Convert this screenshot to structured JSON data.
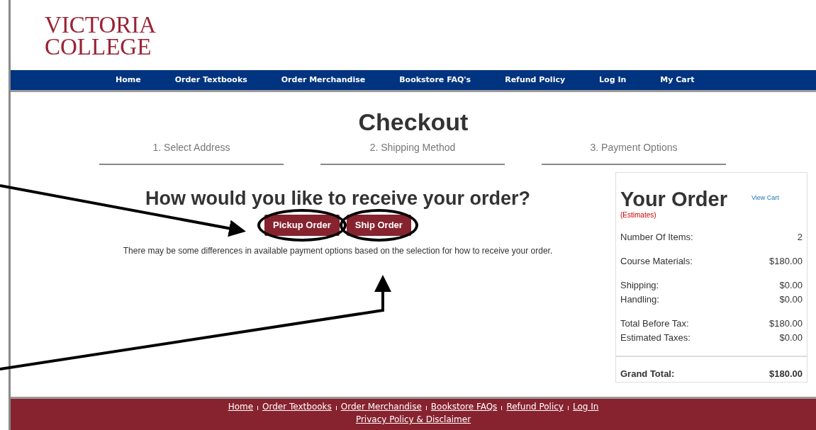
{
  "logo": {
    "line_1": "VICTORIA",
    "line_2": "COLLEGE"
  },
  "nav": [
    "Home",
    "Order Textbooks",
    "Order Merchandise",
    "Bookstore FAQ's",
    "Refund Policy",
    "Log In",
    "My Cart"
  ],
  "page_title": "Checkout",
  "steps": [
    "1. Select Address",
    "2. Shipping Method",
    "3. Payment Options"
  ],
  "question": "How would you like to receive your order?",
  "buttons": [
    "Pickup Order",
    "Ship Order"
  ],
  "note": "There may be some differences in available payment options based on the selection for how to receive your order.",
  "order_summary": {
    "title": "Your Order",
    "subtitle": "(Estimates)",
    "view_cart": "View Cart",
    "groups": [
      [
        {
          "label": "Number Of Items:",
          "value": "2"
        }
      ],
      [
        {
          "label": "Course Materials:",
          "value": "$180.00"
        }
      ],
      [
        {
          "label": "Shipping:",
          "value": "$0.00"
        },
        {
          "label": "Handling:",
          "value": "$0.00"
        }
      ],
      [
        {
          "label": "Total Before Tax:",
          "value": "$180.00"
        },
        {
          "label": "Estimated Taxes:",
          "value": "$0.00"
        }
      ]
    ],
    "grand_total": {
      "label": "Grand Total:",
      "value": "$180.00"
    }
  },
  "footer": {
    "links": [
      "Home",
      "Order Textbooks",
      "Order Merchandise",
      "Bookstore FAQs",
      "Refund Policy",
      "Log In"
    ],
    "bottom_link": "Privacy Policy & Disclaimer"
  }
}
